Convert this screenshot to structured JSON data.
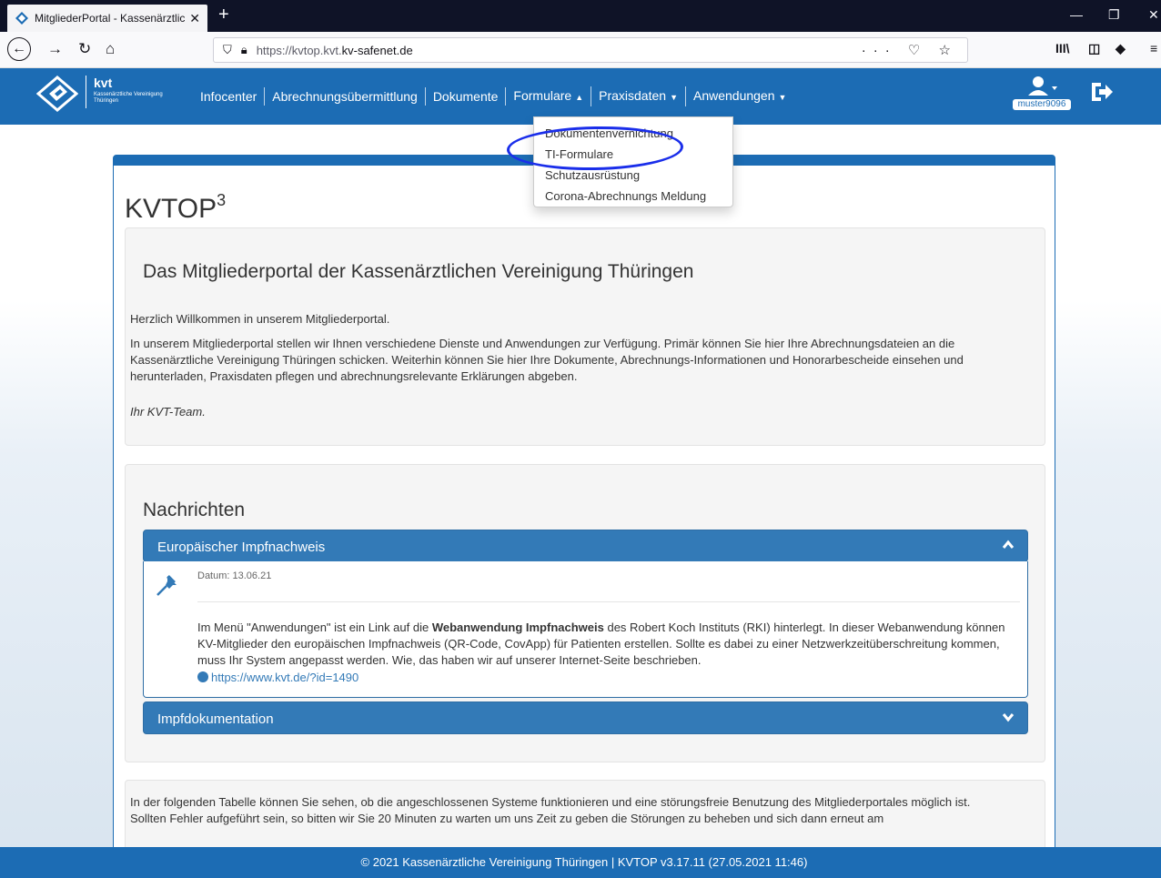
{
  "browser": {
    "tab_title": "MitgliederPortal - Kassenärztlic",
    "tab_close": "✕",
    "new_tab": "+",
    "url_prefix": "https://kvtop.kvt.",
    "url_host": "kv-safenet.de",
    "url_actions": "··· ♡ ☆",
    "toolbar_right": "III\\  ◫  ◆",
    "win_min": "—",
    "win_max": "❐",
    "win_close": "✕"
  },
  "header": {
    "logo_text": "kvt",
    "logo_sub": "Kassenärztliche Vereinigung Thüringen",
    "nav": [
      {
        "label": "Infocenter"
      },
      {
        "label": "Abrechnungsübermittlung"
      },
      {
        "label": "Dokumente"
      },
      {
        "label": "Formulare",
        "caret": "▲"
      },
      {
        "label": "Praxisdaten",
        "caret": "▼"
      },
      {
        "label": "Anwendungen",
        "caret": "▼"
      }
    ],
    "user": "muster9096"
  },
  "dropdown": {
    "items": [
      "Dokumentenvernichtung",
      "TI-Formulare",
      "Schutzausrüstung",
      "Corona-Abrechnungs Meldung"
    ]
  },
  "page": {
    "title": "KVTOP",
    "title_sup": "3"
  },
  "intro": {
    "heading": "Das Mitgliederportal der Kassenärztlichen Vereinigung Thüringen",
    "p1": "Herzlich Willkommen in unserem Mitgliederportal.",
    "p2": "In unserem Mitgliederportal stellen wir Ihnen verschiedene Dienste und Anwendungen zur Verfügung. Primär können Sie hier Ihre Abrechnungsdateien an die Kassenärztliche Vereinigung Thüringen schicken. Weiterhin können Sie hier Ihre Dokumente, Abrechnungs-Informationen und Honorarbescheide einsehen und herunterladen, Praxisdaten pflegen und abrechnungsrelevante Erklärungen abgeben.",
    "signature": "Ihr KVT-Team."
  },
  "news": {
    "heading": "Nachrichten",
    "items": [
      {
        "title": "Europäischer Impfnachweis",
        "date": "Datum: 13.06.21",
        "text_before": "Im Menü \"Anwendungen\" ist ein Link auf die ",
        "text_bold": "Webanwendung Impfnachweis",
        "text_after": " des Robert Koch Instituts (RKI) hinterlegt. In dieser Webanwendung können KV-Mitglieder den europäischen Impfnachweis (QR-Code, CovApp) für Patienten erstellen. Sollte es dabei zu einer Netzwerkzeitüberschreitung kommen, muss Ihr System angepasst werden. Wie, das haben wir auf unserer Internet-Seite beschrieben.",
        "link": "https://www.kvt.de/?id=1490"
      },
      {
        "title": "Impfdokumentation"
      }
    ]
  },
  "status_section": {
    "text": "In der folgenden Tabelle können Sie sehen, ob die angeschlossenen Systeme funktionieren und eine störungsfreie Benutzung des Mitgliederportales möglich ist.",
    "text2": "Sollten Fehler aufgeführt sein, so bitten wir Sie 20 Minuten zu warten um uns Zeit zu geben die Störungen zu beheben und sich dann erneut am"
  },
  "footer": {
    "text": "© 2021 Kassenärztliche Vereinigung Thüringen  | KVTOP v3.17.11 (27.05.2021 11:46)"
  },
  "colors": {
    "brand_blue": "#1c6cb4",
    "panel_blue": "#337ab7",
    "annotation_ellipse": "#1a2eea"
  }
}
